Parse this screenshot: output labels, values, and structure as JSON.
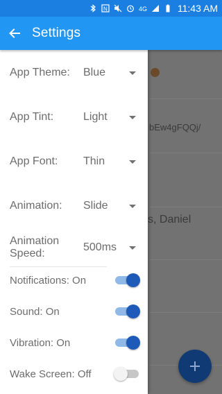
{
  "status_bar": {
    "time": "11:43 AM",
    "icons": [
      "bluetooth-icon",
      "nfc-icon",
      "mute-icon",
      "alarm-icon",
      "4g-icon",
      "signal-icon",
      "battery-icon"
    ]
  },
  "app_bar": {
    "title": "Settings",
    "back_icon": "arrow-left-icon",
    "color": "#2196f3"
  },
  "settings": {
    "app_theme": {
      "label": "App Theme:",
      "value": "Blue"
    },
    "app_tint": {
      "label": "App Tint:",
      "value": "Light"
    },
    "app_font": {
      "label": "App Font:",
      "value": "Thin"
    },
    "animation": {
      "label": "Animation:",
      "value": "Slide"
    },
    "animation_speed": {
      "label": "Animation Speed:",
      "value": "500ms"
    },
    "notifications": {
      "label": "Notifications: On",
      "on": true
    },
    "sound": {
      "label": "Sound: On",
      "on": true
    },
    "vibration": {
      "label": "Vibration: On",
      "on": true
    },
    "wake_screen": {
      "label": "Wake Screen: Off",
      "on": false
    }
  },
  "background": {
    "text_url_fragment": "bEw4gFQQj/",
    "text_name_fragment": "s, Daniel"
  },
  "fab": {
    "icon": "plus-icon",
    "color": "#103a74"
  }
}
